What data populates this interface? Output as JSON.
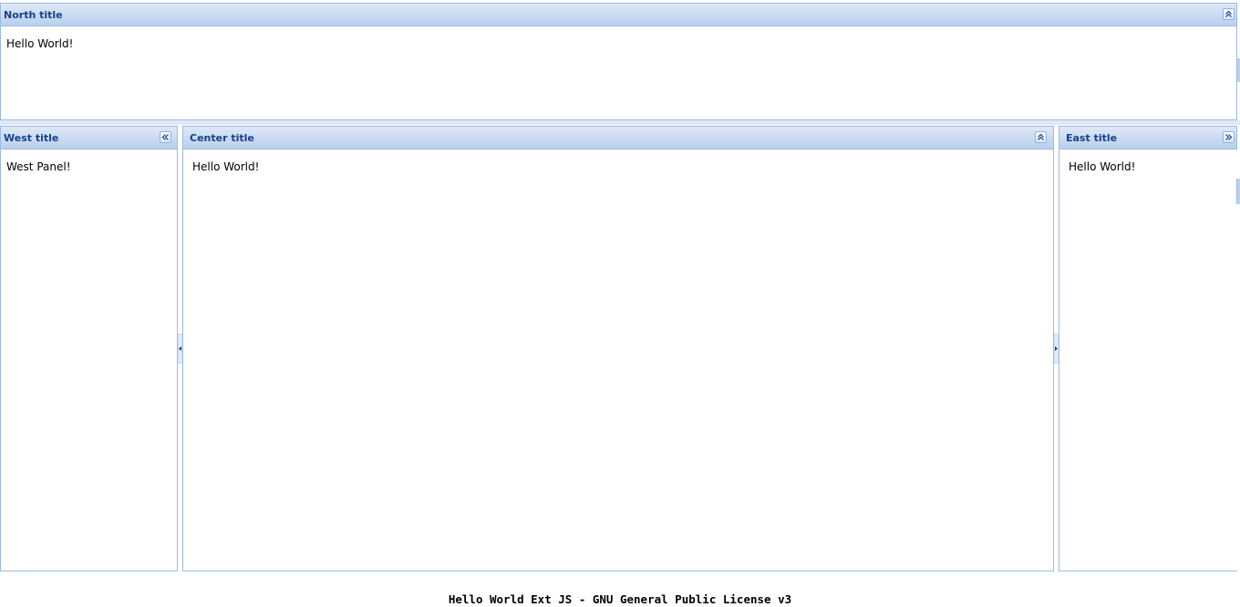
{
  "north": {
    "title": "North title",
    "body": "Hello World!",
    "tool_icon": "collapse-up-icon"
  },
  "west": {
    "title": "West title",
    "body": "West Panel!",
    "tool_icon": "collapse-left-icon"
  },
  "center": {
    "title": "Center title",
    "body": "Hello World!",
    "tool_icon": "collapse-up-icon"
  },
  "east": {
    "title": "East title",
    "body": "Hello World!",
    "tool_icon": "collapse-right-icon"
  },
  "footer": {
    "text": "Hello World Ext JS - GNU General Public License v3"
  },
  "colors": {
    "header_text": "#15428b",
    "border": "#99bbe8",
    "header_bg": "#cbdcf2",
    "splitter": "#dfe8f6"
  }
}
